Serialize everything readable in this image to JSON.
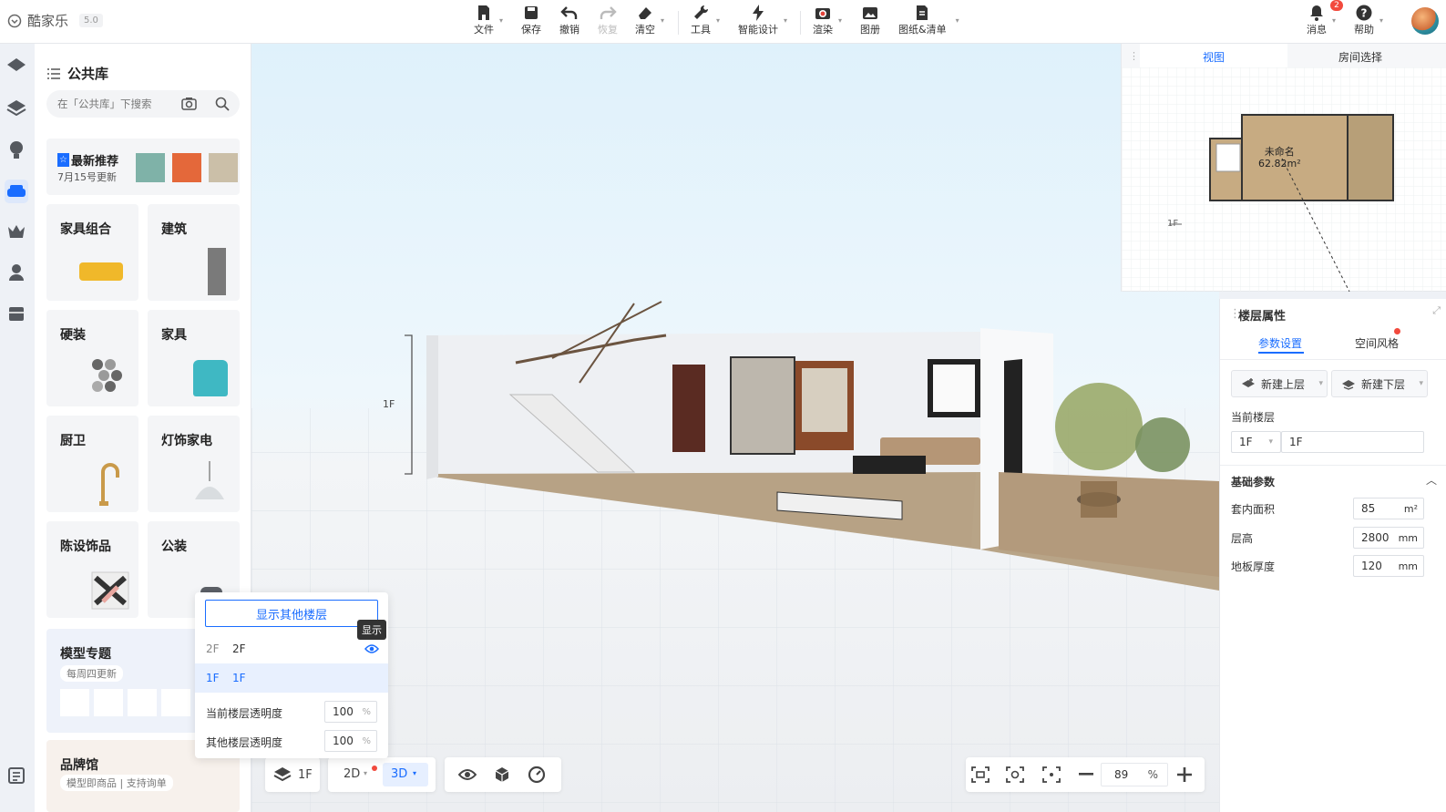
{
  "app": {
    "name": "酷家乐",
    "version": "5.0"
  },
  "toolbar": {
    "file": "文件",
    "save": "保存",
    "undo": "撤销",
    "redo": "恢复",
    "clear": "清空",
    "tools": "工具",
    "smart_design": "智能设计",
    "render": "渲染",
    "album": "图册",
    "drawings": "图纸&清单",
    "messages": "消息",
    "message_count": "2",
    "help": "帮助"
  },
  "library": {
    "title": "公共库",
    "search_placeholder": "在「公共库」下搜索",
    "recommend": {
      "title": "最新推荐",
      "subtitle": "7月15号更新"
    },
    "categories": [
      "家具组合",
      "建筑",
      "硬装",
      "家具",
      "厨卫",
      "灯饰家电",
      "陈设饰品",
      "公装"
    ],
    "topic": {
      "title": "模型专题",
      "subtitle": "每周四更新"
    },
    "brand": {
      "title": "品牌馆",
      "subtitle": "模型即商品 | 支持询单"
    }
  },
  "floor_popup": {
    "show_other_button": "显示其他楼层",
    "tooltip": "显示",
    "floors": [
      {
        "code": "2F",
        "name": "2F",
        "selected": false
      },
      {
        "code": "1F",
        "name": "1F",
        "selected": true
      }
    ],
    "current_opacity_label": "当前楼层透明度",
    "current_opacity": "100",
    "other_opacity_label": "其他楼层透明度",
    "other_opacity": "100",
    "percent": "%"
  },
  "bottom": {
    "floor": "1F",
    "mode_2d": "2D",
    "mode_3d": "3D",
    "zoom": "89",
    "percent": "%"
  },
  "scene": {
    "floor_label": "1F"
  },
  "minimap": {
    "tab_view": "视图",
    "tab_room": "房间选择",
    "room_name": "未命名",
    "room_area": "62.82m²",
    "floor_marker": "1F"
  },
  "properties": {
    "title": "楼层属性",
    "tab_params": "参数设置",
    "tab_style": "空间风格",
    "new_upper": "新建上层",
    "new_lower": "新建下层",
    "current_floor_label": "当前楼层",
    "current_floor_code": "1F",
    "current_floor_name": "1F",
    "basic_params": "基础参数",
    "area_label": "套内面积",
    "area_value": "85",
    "area_unit": "m²",
    "height_label": "层高",
    "height_value": "2800",
    "height_unit": "mm",
    "thickness_label": "地板厚度",
    "thickness_value": "120",
    "thickness_unit": "mm"
  },
  "colors": {
    "accent": "#1a6dff",
    "badge": "#f24a3d"
  }
}
